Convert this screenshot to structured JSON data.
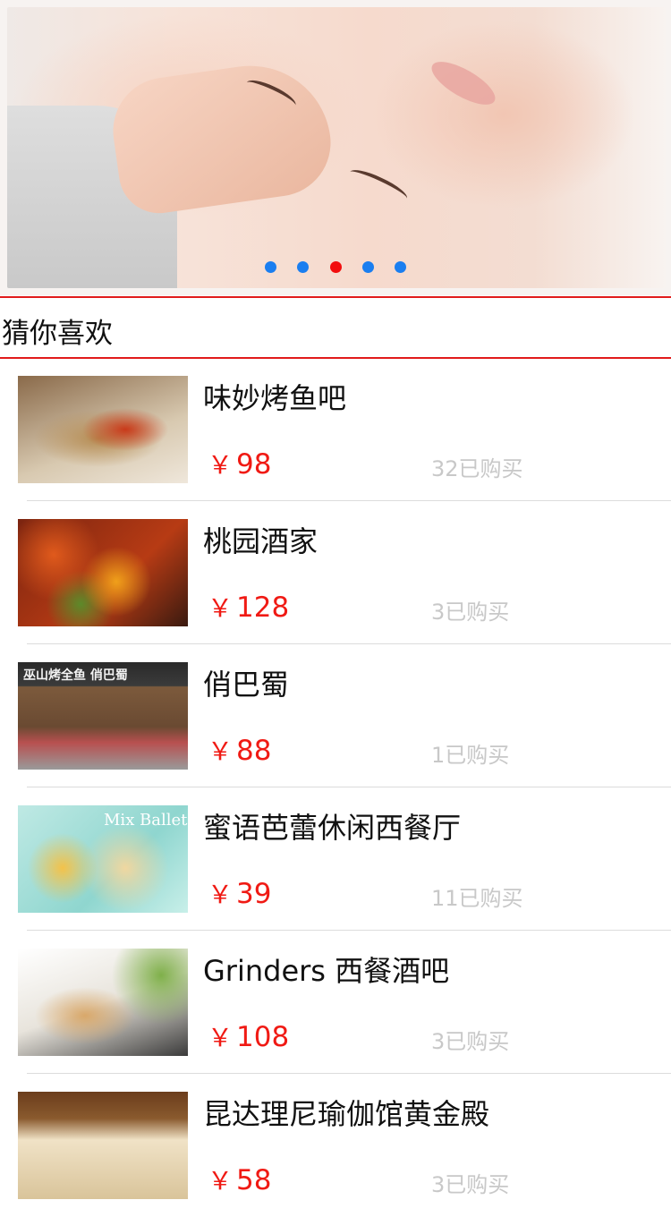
{
  "banner": {
    "image": "massage-face-photo",
    "dots": [
      false,
      false,
      true,
      false,
      false
    ]
  },
  "section": {
    "title": "猜你喜欢"
  },
  "items": [
    {
      "name": "味妙烤鱼吧",
      "price": "98",
      "sold": "32已购买",
      "image": "grilled-fish-photo"
    },
    {
      "name": "桃园酒家",
      "price": "128",
      "sold": "3已购买",
      "image": "spicy-dish-photo"
    },
    {
      "name": "俏巴蜀",
      "price": "88",
      "sold": "1已购买",
      "image": "restaurant-storefront-photo"
    },
    {
      "name": "蜜语芭蕾休闲西餐厅",
      "price": "39",
      "sold": "11已购买",
      "image": "mix-ballet-menu-photo"
    },
    {
      "name": "Grinders 西餐酒吧",
      "price": "108",
      "sold": "3已购买",
      "image": "sandwich-photo"
    },
    {
      "name": "昆达理尼瑜伽馆黄金殿",
      "price": "58",
      "sold": "3已购买",
      "image": "yoga-hall-photo"
    }
  ],
  "currency": "￥",
  "thumb_texts": {
    "t2": "巫山烤全鱼 俏巴蜀",
    "t3": "Mix Ballet"
  }
}
